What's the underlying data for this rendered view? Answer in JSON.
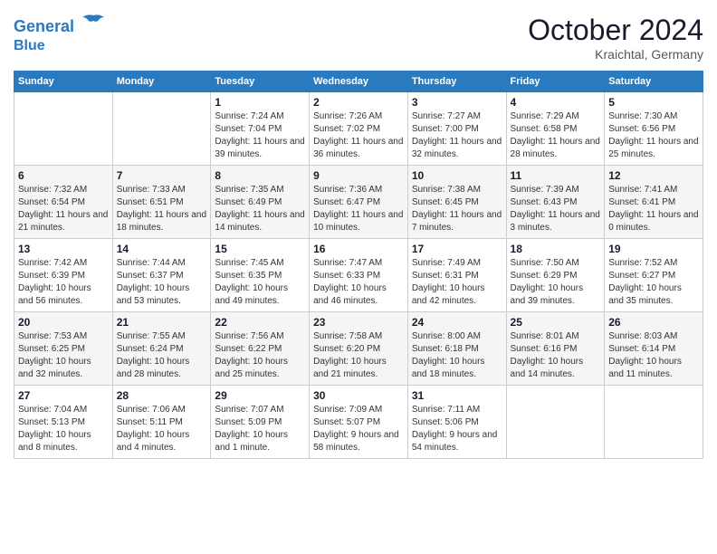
{
  "header": {
    "logo_line1": "General",
    "logo_line2": "Blue",
    "month_title": "October 2024",
    "location": "Kraichtal, Germany"
  },
  "weekdays": [
    "Sunday",
    "Monday",
    "Tuesday",
    "Wednesday",
    "Thursday",
    "Friday",
    "Saturday"
  ],
  "weeks": [
    [
      {
        "day": "",
        "info": ""
      },
      {
        "day": "",
        "info": ""
      },
      {
        "day": "1",
        "info": "Sunrise: 7:24 AM\nSunset: 7:04 PM\nDaylight: 11 hours and 39 minutes."
      },
      {
        "day": "2",
        "info": "Sunrise: 7:26 AM\nSunset: 7:02 PM\nDaylight: 11 hours and 36 minutes."
      },
      {
        "day": "3",
        "info": "Sunrise: 7:27 AM\nSunset: 7:00 PM\nDaylight: 11 hours and 32 minutes."
      },
      {
        "day": "4",
        "info": "Sunrise: 7:29 AM\nSunset: 6:58 PM\nDaylight: 11 hours and 28 minutes."
      },
      {
        "day": "5",
        "info": "Sunrise: 7:30 AM\nSunset: 6:56 PM\nDaylight: 11 hours and 25 minutes."
      }
    ],
    [
      {
        "day": "6",
        "info": "Sunrise: 7:32 AM\nSunset: 6:54 PM\nDaylight: 11 hours and 21 minutes."
      },
      {
        "day": "7",
        "info": "Sunrise: 7:33 AM\nSunset: 6:51 PM\nDaylight: 11 hours and 18 minutes."
      },
      {
        "day": "8",
        "info": "Sunrise: 7:35 AM\nSunset: 6:49 PM\nDaylight: 11 hours and 14 minutes."
      },
      {
        "day": "9",
        "info": "Sunrise: 7:36 AM\nSunset: 6:47 PM\nDaylight: 11 hours and 10 minutes."
      },
      {
        "day": "10",
        "info": "Sunrise: 7:38 AM\nSunset: 6:45 PM\nDaylight: 11 hours and 7 minutes."
      },
      {
        "day": "11",
        "info": "Sunrise: 7:39 AM\nSunset: 6:43 PM\nDaylight: 11 hours and 3 minutes."
      },
      {
        "day": "12",
        "info": "Sunrise: 7:41 AM\nSunset: 6:41 PM\nDaylight: 11 hours and 0 minutes."
      }
    ],
    [
      {
        "day": "13",
        "info": "Sunrise: 7:42 AM\nSunset: 6:39 PM\nDaylight: 10 hours and 56 minutes."
      },
      {
        "day": "14",
        "info": "Sunrise: 7:44 AM\nSunset: 6:37 PM\nDaylight: 10 hours and 53 minutes."
      },
      {
        "day": "15",
        "info": "Sunrise: 7:45 AM\nSunset: 6:35 PM\nDaylight: 10 hours and 49 minutes."
      },
      {
        "day": "16",
        "info": "Sunrise: 7:47 AM\nSunset: 6:33 PM\nDaylight: 10 hours and 46 minutes."
      },
      {
        "day": "17",
        "info": "Sunrise: 7:49 AM\nSunset: 6:31 PM\nDaylight: 10 hours and 42 minutes."
      },
      {
        "day": "18",
        "info": "Sunrise: 7:50 AM\nSunset: 6:29 PM\nDaylight: 10 hours and 39 minutes."
      },
      {
        "day": "19",
        "info": "Sunrise: 7:52 AM\nSunset: 6:27 PM\nDaylight: 10 hours and 35 minutes."
      }
    ],
    [
      {
        "day": "20",
        "info": "Sunrise: 7:53 AM\nSunset: 6:25 PM\nDaylight: 10 hours and 32 minutes."
      },
      {
        "day": "21",
        "info": "Sunrise: 7:55 AM\nSunset: 6:24 PM\nDaylight: 10 hours and 28 minutes."
      },
      {
        "day": "22",
        "info": "Sunrise: 7:56 AM\nSunset: 6:22 PM\nDaylight: 10 hours and 25 minutes."
      },
      {
        "day": "23",
        "info": "Sunrise: 7:58 AM\nSunset: 6:20 PM\nDaylight: 10 hours and 21 minutes."
      },
      {
        "day": "24",
        "info": "Sunrise: 8:00 AM\nSunset: 6:18 PM\nDaylight: 10 hours and 18 minutes."
      },
      {
        "day": "25",
        "info": "Sunrise: 8:01 AM\nSunset: 6:16 PM\nDaylight: 10 hours and 14 minutes."
      },
      {
        "day": "26",
        "info": "Sunrise: 8:03 AM\nSunset: 6:14 PM\nDaylight: 10 hours and 11 minutes."
      }
    ],
    [
      {
        "day": "27",
        "info": "Sunrise: 7:04 AM\nSunset: 5:13 PM\nDaylight: 10 hours and 8 minutes."
      },
      {
        "day": "28",
        "info": "Sunrise: 7:06 AM\nSunset: 5:11 PM\nDaylight: 10 hours and 4 minutes."
      },
      {
        "day": "29",
        "info": "Sunrise: 7:07 AM\nSunset: 5:09 PM\nDaylight: 10 hours and 1 minute."
      },
      {
        "day": "30",
        "info": "Sunrise: 7:09 AM\nSunset: 5:07 PM\nDaylight: 9 hours and 58 minutes."
      },
      {
        "day": "31",
        "info": "Sunrise: 7:11 AM\nSunset: 5:06 PM\nDaylight: 9 hours and 54 minutes."
      },
      {
        "day": "",
        "info": ""
      },
      {
        "day": "",
        "info": ""
      }
    ]
  ]
}
